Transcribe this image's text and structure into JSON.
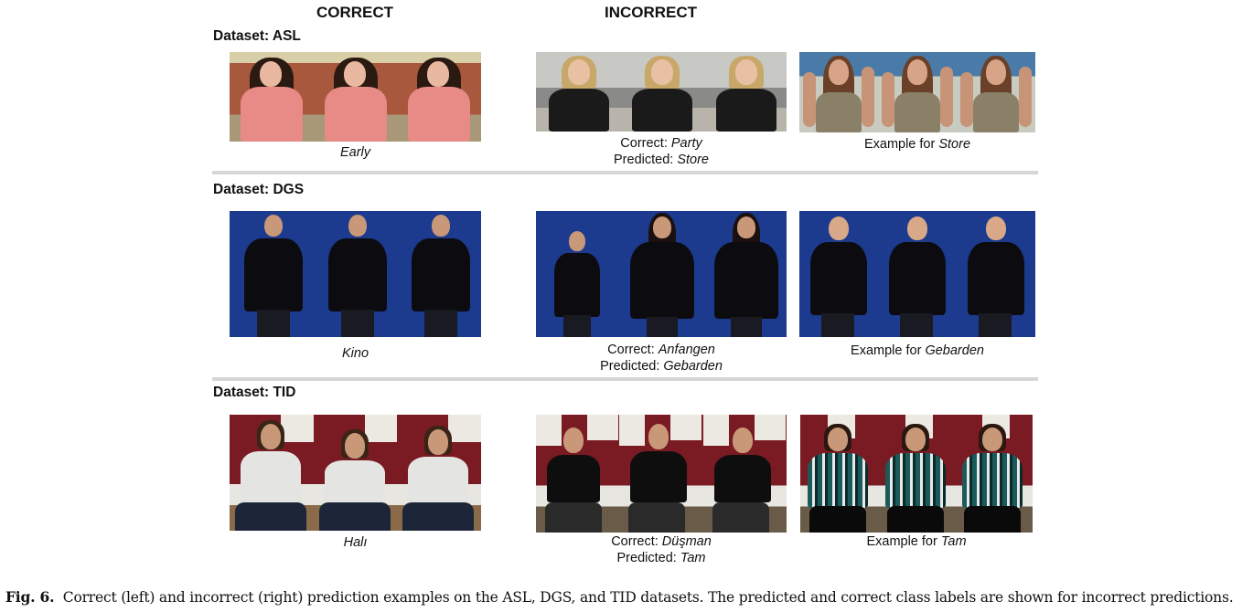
{
  "column_headers": {
    "correct": "CORRECT",
    "incorrect": "INCORRECT"
  },
  "rows": [
    {
      "dataset_label": "Dataset: ASL",
      "correct": {
        "label": "Early",
        "image": "asl-correct-early-frames"
      },
      "incorrect": {
        "correct_prefix": "Correct: ",
        "correct_label": "Party",
        "predicted_prefix": "Predicted: ",
        "predicted_label": "Store",
        "image": "asl-incorrect-party-frames"
      },
      "example": {
        "prefix": "Example for ",
        "label": "Store",
        "image": "asl-example-store-frames"
      }
    },
    {
      "dataset_label": "Dataset: DGS",
      "correct": {
        "label": "Kino",
        "image": "dgs-correct-kino-frames"
      },
      "incorrect": {
        "correct_prefix": "Correct: ",
        "correct_label": "Anfangen",
        "predicted_prefix": "Predicted: ",
        "predicted_label": "Gebarden",
        "image": "dgs-incorrect-anfangen-frames"
      },
      "example": {
        "prefix": "Example for ",
        "label": "Gebarden",
        "image": "dgs-example-gebarden-frames"
      }
    },
    {
      "dataset_label": "Dataset: TID",
      "correct": {
        "label": "Halı",
        "image": "tid-correct-hali-frames"
      },
      "incorrect": {
        "correct_prefix": "Correct: ",
        "correct_label": "Düşman",
        "predicted_prefix": "Predicted: ",
        "predicted_label": "Tam",
        "image": "tid-incorrect-dusman-frames"
      },
      "example": {
        "prefix": "Example for ",
        "label": "Tam",
        "image": "tid-example-tam-frames"
      }
    }
  ],
  "figure_caption": {
    "label": "Fig. 6.",
    "text": "Correct (left) and incorrect (right) prediction examples on the ASL, DGS, and TID datasets. The predicted and correct class labels are shown for incorrect predictions."
  },
  "colors": {
    "separator": "#d6d6d6",
    "asl_bg": "#8a5a3c",
    "dgs_bg": "#1d3a8c",
    "tid_bg": "#7a1a22"
  }
}
